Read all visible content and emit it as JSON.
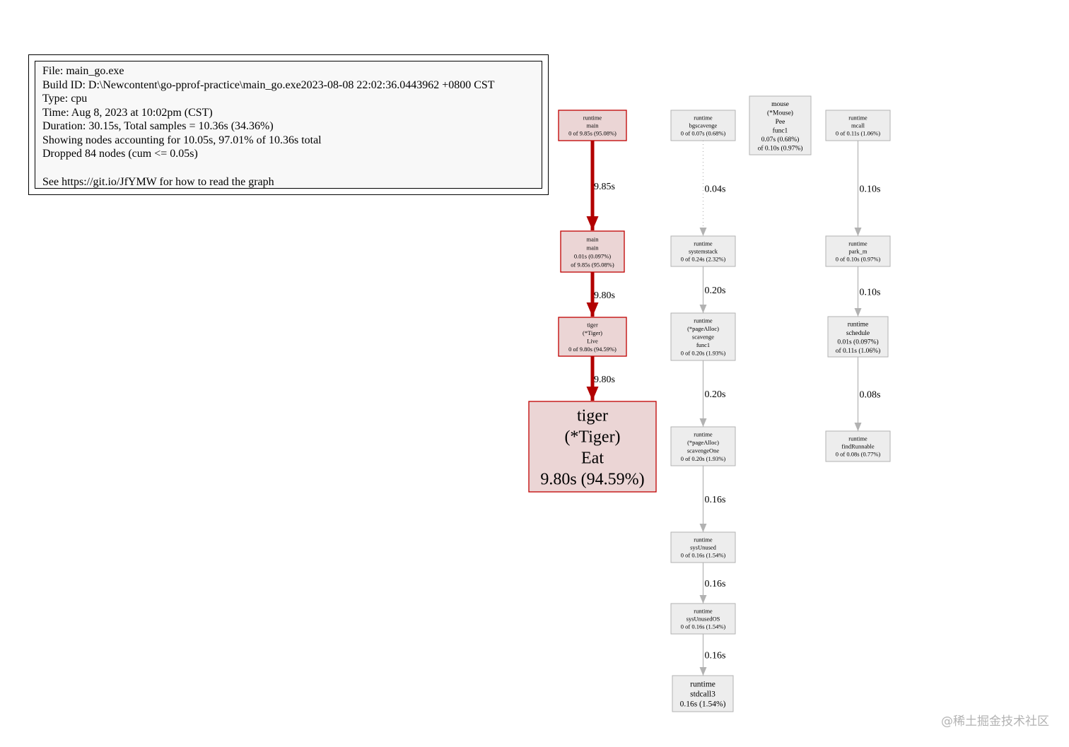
{
  "legend": {
    "file": "File: main_go.exe",
    "build_id": "Build ID: D:\\Newcontent\\go-pprof-practice\\main_go.exe2023-08-08 22:02:36.0443962 +0800 CST",
    "type": "Type: cpu",
    "time": "Time: Aug 8, 2023 at 10:02pm (CST)",
    "duration": "Duration: 30.15s, Total samples = 10.36s (34.36%)",
    "showing": "Showing nodes accounting for 10.05s, 97.01% of 10.36s total",
    "dropped": "Dropped 84 nodes (cum <= 0.05s)",
    "see": "See https://git.io/JfYMW for how to read the graph"
  },
  "colors": {
    "hot_fill": "#ebd5d5",
    "hot_border": "#c00000",
    "hot_edge": "#b20000",
    "cold_fill": "#ededed",
    "cold_border": "#b2b2b2",
    "cold_edge": "#b2b2b2"
  },
  "nodes": [
    {
      "id": "runtime-main",
      "hot": true,
      "lines": [
        "runtime",
        "main",
        "0 of 9.85s (95.08%)"
      ]
    },
    {
      "id": "main-main",
      "hot": true,
      "lines": [
        "main",
        "main",
        "0.01s (0.097%)",
        "of 9.85s (95.08%)"
      ]
    },
    {
      "id": "tiger-live",
      "hot": true,
      "lines": [
        "tiger",
        "(*Tiger)",
        "Live",
        "0 of 9.80s (94.59%)"
      ]
    },
    {
      "id": "tiger-eat",
      "hot": true,
      "lines": [
        "tiger",
        "(*Tiger)",
        "Eat",
        "9.80s (94.59%)"
      ]
    },
    {
      "id": "runtime-bgscavenge",
      "hot": false,
      "lines": [
        "runtime",
        "bgscavenge",
        "0 of 0.07s (0.68%)"
      ]
    },
    {
      "id": "runtime-systemstack",
      "hot": false,
      "lines": [
        "runtime",
        "systemstack",
        "0 of 0.24s (2.32%)"
      ]
    },
    {
      "id": "runtime-scavenge-func1",
      "hot": false,
      "lines": [
        "runtime",
        "(*pageAlloc)",
        "scavenge",
        "func1",
        "0 of 0.20s (1.93%)"
      ]
    },
    {
      "id": "runtime-scavengeone",
      "hot": false,
      "lines": [
        "runtime",
        "(*pageAlloc)",
        "scavengeOne",
        "0 of 0.20s (1.93%)"
      ]
    },
    {
      "id": "runtime-sysunused",
      "hot": false,
      "lines": [
        "runtime",
        "sysUnused",
        "0 of 0.16s (1.54%)"
      ]
    },
    {
      "id": "runtime-sysunusedos",
      "hot": false,
      "lines": [
        "runtime",
        "sysUnusedOS",
        "0 of 0.16s (1.54%)"
      ]
    },
    {
      "id": "runtime-stdcall3",
      "hot": false,
      "lines": [
        "runtime",
        "stdcall3",
        "0.16s (1.54%)"
      ]
    },
    {
      "id": "mouse-pee-func1",
      "hot": false,
      "lines": [
        "mouse",
        "(*Mouse)",
        "Pee",
        "func1",
        "0.07s (0.68%)",
        "of 0.10s (0.97%)"
      ]
    },
    {
      "id": "runtime-mcall",
      "hot": false,
      "lines": [
        "runtime",
        "mcall",
        "0 of 0.11s (1.06%)"
      ]
    },
    {
      "id": "runtime-park-m",
      "hot": false,
      "lines": [
        "runtime",
        "park_m",
        "0 of 0.10s (0.97%)"
      ]
    },
    {
      "id": "runtime-schedule",
      "hot": false,
      "lines": [
        "runtime",
        "schedule",
        "0.01s (0.097%)",
        "of 0.11s (1.06%)"
      ]
    },
    {
      "id": "runtime-findrunnable",
      "hot": false,
      "lines": [
        "runtime",
        "findRunnable",
        "0 of 0.08s (0.77%)"
      ]
    }
  ],
  "edges": [
    {
      "from": "runtime-main",
      "to": "main-main",
      "label": "9.85s",
      "hot": true,
      "dashed": false
    },
    {
      "from": "main-main",
      "to": "tiger-live",
      "label": "9.80s",
      "hot": true,
      "dashed": false
    },
    {
      "from": "tiger-live",
      "to": "tiger-eat",
      "label": "9.80s",
      "hot": true,
      "dashed": false
    },
    {
      "from": "runtime-bgscavenge",
      "to": "runtime-systemstack",
      "label": "0.04s",
      "hot": false,
      "dashed": true
    },
    {
      "from": "runtime-systemstack",
      "to": "runtime-scavenge-func1",
      "label": "0.20s",
      "hot": false,
      "dashed": false
    },
    {
      "from": "runtime-scavenge-func1",
      "to": "runtime-scavengeone",
      "label": "0.20s",
      "hot": false,
      "dashed": false
    },
    {
      "from": "runtime-scavengeone",
      "to": "runtime-sysunused",
      "label": "0.16s",
      "hot": false,
      "dashed": false
    },
    {
      "from": "runtime-sysunused",
      "to": "runtime-sysunusedos",
      "label": "0.16s",
      "hot": false,
      "dashed": false
    },
    {
      "from": "runtime-sysunusedos",
      "to": "runtime-stdcall3",
      "label": "0.16s",
      "hot": false,
      "dashed": false
    },
    {
      "from": "runtime-mcall",
      "to": "runtime-park-m",
      "label": "0.10s",
      "hot": false,
      "dashed": false
    },
    {
      "from": "runtime-park-m",
      "to": "runtime-schedule",
      "label": "0.10s",
      "hot": false,
      "dashed": false
    },
    {
      "from": "runtime-schedule",
      "to": "runtime-findrunnable",
      "label": "0.08s",
      "hot": false,
      "dashed": false
    }
  ],
  "watermark": "@稀土掘金技术社区"
}
